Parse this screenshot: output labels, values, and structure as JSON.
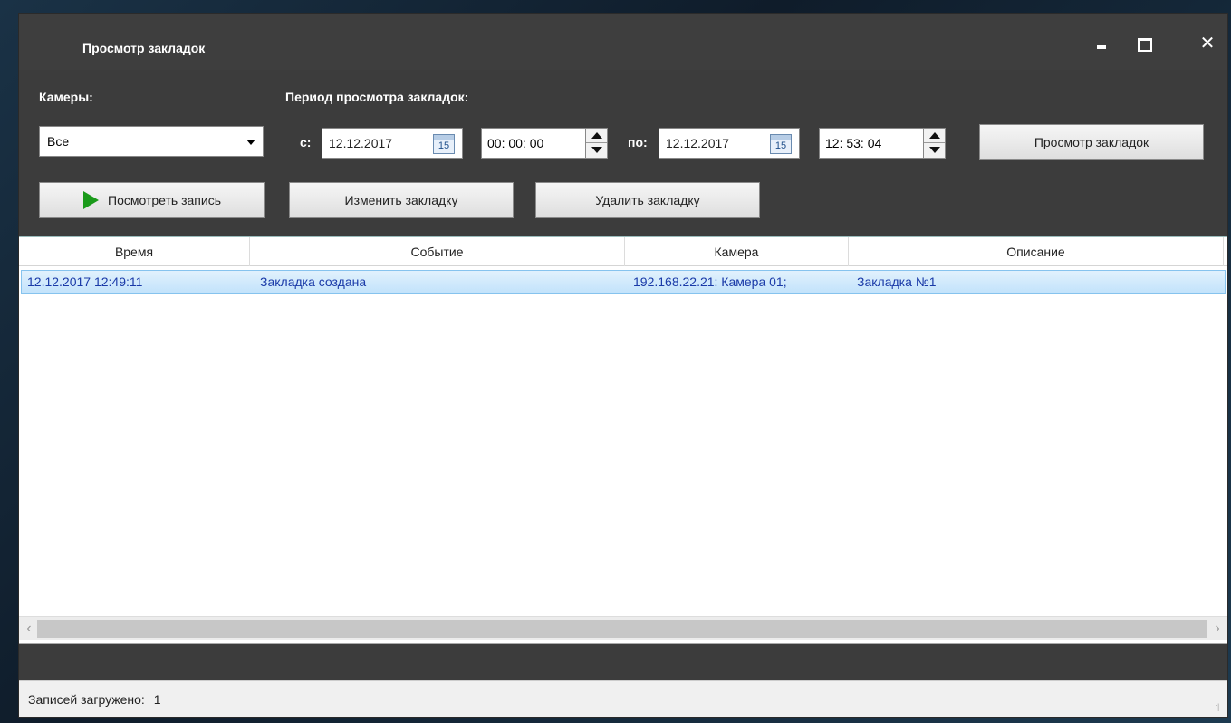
{
  "window": {
    "title": "Просмотр закладок",
    "close_glyph": "✕"
  },
  "filters": {
    "cameras_label": "Камеры:",
    "cameras_value": "Все",
    "period_label": "Период просмотра закладок:",
    "from_label": "с:",
    "from_date": "12.12.2017",
    "from_time": "00: 00: 00",
    "to_label": "по:",
    "to_date": "12.12.2017",
    "to_time": "12: 53: 04",
    "calendar_day": "15",
    "view_bookmarks_button": "Просмотр закладок"
  },
  "actions": {
    "play_record": "Посмотреть запись",
    "edit_bookmark": "Изменить закладку",
    "delete_bookmark": "Удалить закладку"
  },
  "table": {
    "columns": [
      "Время",
      "Событие",
      "Камера",
      "Описание"
    ],
    "rows": [
      [
        "12.12.2017 12:49:11",
        "Закладка создана",
        "192.168.22.21: Камера 01;",
        "Закладка №1"
      ]
    ]
  },
  "scroll": {
    "left": "‹",
    "right": "›"
  },
  "status": {
    "records_loaded_label": "Записей загружено:",
    "records_loaded_count": "1",
    "grip_glyph": ".:|"
  },
  "icons": {
    "play": "play-icon",
    "calendar": "calendar-icon",
    "dropdown": "chevron-down-icon"
  },
  "colors": {
    "window_bg": "#3c3c3c",
    "selected_row": "#c3e3fb",
    "row_text": "#1a3aa8",
    "play_green": "#1a9a1a"
  }
}
